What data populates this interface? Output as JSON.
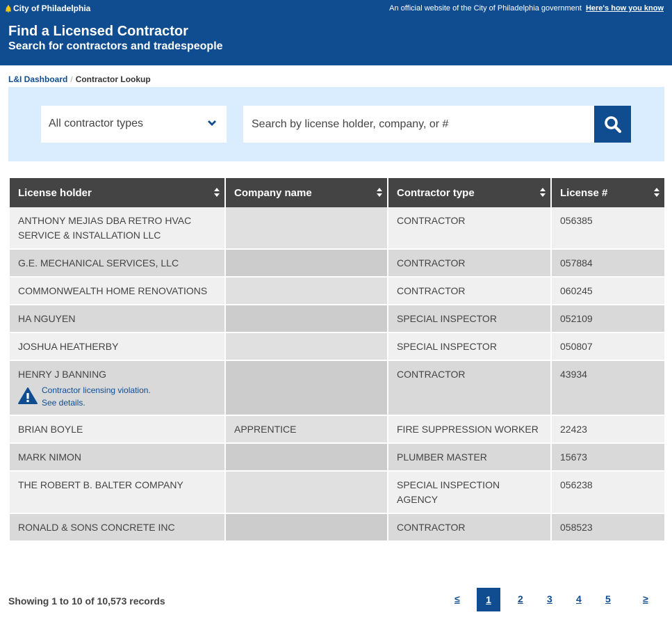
{
  "utility": {
    "brand": "City of Philadelphia",
    "official_text": "An official website of the City of Philadelphia government",
    "how_link": "Here's how you know"
  },
  "header": {
    "title": "Find a Licensed Contractor",
    "subtitle": "Search for contractors and tradespeople"
  },
  "breadcrumb": {
    "parent": "L&I Dashboard",
    "separator": "/",
    "current": "Contractor Lookup"
  },
  "search": {
    "type_selected": "All contractor types",
    "placeholder": "Search by license holder, company, or #"
  },
  "table": {
    "columns": [
      "License holder",
      "Company name",
      "Contractor type",
      "License #"
    ],
    "rows": [
      {
        "holder": "ANTHONY MEJIAS DBA RETRO HVAC SERVICE & INSTALLATION LLC",
        "company": "",
        "type": "CONTRACTOR",
        "license": "056385"
      },
      {
        "holder": "G.E. MECHANICAL SERVICES, LLC",
        "company": "",
        "type": "CONTRACTOR",
        "license": "057884"
      },
      {
        "holder": "COMMONWEALTH HOME RENOVATIONS",
        "company": "",
        "type": "CONTRACTOR",
        "license": "060245"
      },
      {
        "holder": "HA NGUYEN",
        "company": "",
        "type": "SPECIAL INSPECTOR",
        "license": "052109"
      },
      {
        "holder": "JOSHUA HEATHERBY",
        "company": "",
        "type": "SPECIAL INSPECTOR",
        "license": "050807"
      },
      {
        "holder": "HENRY J BANNING",
        "company": "",
        "type": "CONTRACTOR",
        "license": "43934",
        "violation_line1": "Contractor licensing violation.",
        "violation_line2": "See details."
      },
      {
        "holder": "BRIAN BOYLE",
        "company": "APPRENTICE",
        "type": "FIRE SUPPRESSION WORKER",
        "license": "22423"
      },
      {
        "holder": "MARK NIMON",
        "company": "",
        "type": "PLUMBER MASTER",
        "license": "15673"
      },
      {
        "holder": "THE ROBERT B. BALTER COMPANY",
        "company": "",
        "type": "SPECIAL INSPECTION AGENCY",
        "license": "056238"
      },
      {
        "holder": "RONALD & SONS CONCRETE INC",
        "company": "",
        "type": "CONTRACTOR",
        "license": "058523"
      }
    ]
  },
  "footer": {
    "results_text": "Showing 1 to 10 of 10,573 records",
    "pagination": {
      "prev": "≤",
      "pages": [
        "1",
        "2",
        "3",
        "4",
        "5"
      ],
      "next": "≥",
      "current": "1"
    }
  },
  "colors": {
    "brand_blue": "#0f4d90",
    "panel_blue": "#daedfe",
    "header_gray": "#444444"
  }
}
